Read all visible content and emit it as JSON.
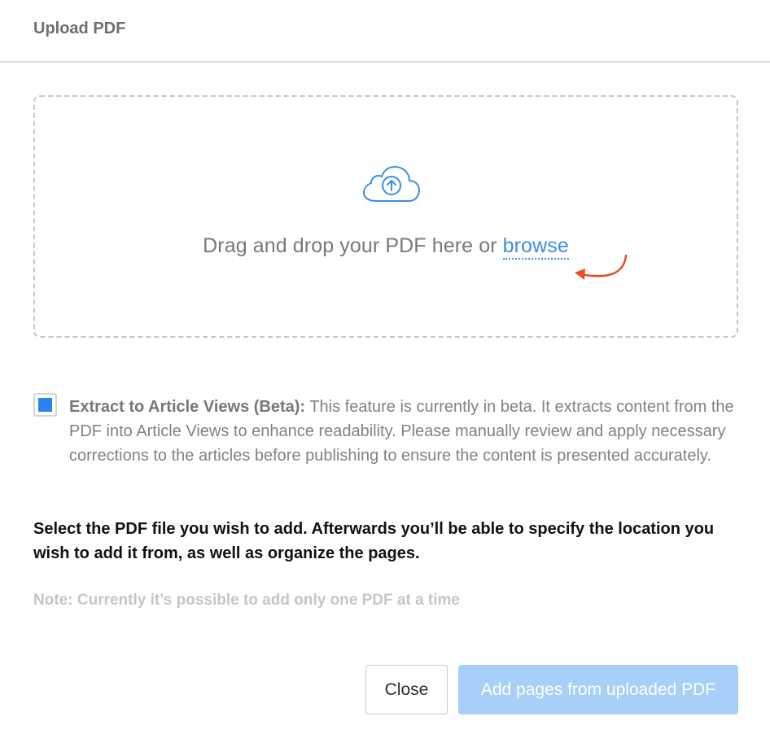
{
  "dialog": {
    "title": "Upload PDF"
  },
  "dropzone": {
    "icon": "cloud-upload-icon",
    "text": "Drag and drop your PDF here or",
    "browse_label": "browse",
    "accent_color": "#3a8ee6",
    "annotation_arrow_color": "#e2512c"
  },
  "extract": {
    "checked": true,
    "title": "Extract to Article Views (Beta):",
    "description": "This feature is currently in beta. It extracts content from the PDF into Article Views to enhance readability. Please manually review and apply necessary corrections to the articles before publishing to ensure the content is presented accurately."
  },
  "instructions": "Select the PDF file you wish to add. Afterwards you’ll be able to specify the location you wish to add it from, as well as organize the pages.",
  "note": {
    "label": "Note:",
    "text": "Currently it’s possible to add only one PDF at a time"
  },
  "buttons": {
    "close_label": "Close",
    "add_label": "Add pages from uploaded PDF",
    "add_disabled": true,
    "primary_color": "#a7cff7"
  }
}
